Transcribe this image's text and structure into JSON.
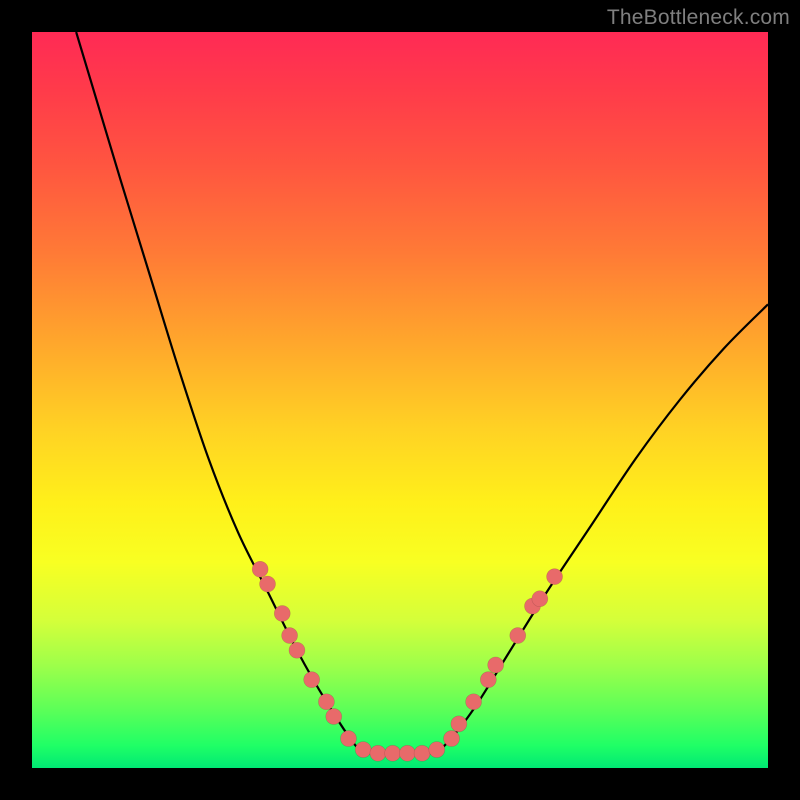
{
  "watermark": "TheBottleneck.com",
  "chart_data": {
    "type": "line",
    "title": "",
    "xlabel": "",
    "ylabel": "",
    "xlim": [
      0,
      100
    ],
    "ylim": [
      0,
      100
    ],
    "curve_left": [
      {
        "x": 6,
        "y": 100
      },
      {
        "x": 9,
        "y": 90
      },
      {
        "x": 12,
        "y": 80
      },
      {
        "x": 16,
        "y": 67
      },
      {
        "x": 20,
        "y": 54
      },
      {
        "x": 24,
        "y": 42
      },
      {
        "x": 28,
        "y": 32
      },
      {
        "x": 32,
        "y": 24
      },
      {
        "x": 36,
        "y": 16
      },
      {
        "x": 40,
        "y": 9
      },
      {
        "x": 44,
        "y": 3
      }
    ],
    "curve_flat": [
      {
        "x": 44,
        "y": 3
      },
      {
        "x": 46,
        "y": 2
      },
      {
        "x": 50,
        "y": 2
      },
      {
        "x": 54,
        "y": 2
      },
      {
        "x": 56,
        "y": 3
      }
    ],
    "curve_right": [
      {
        "x": 56,
        "y": 3
      },
      {
        "x": 60,
        "y": 8
      },
      {
        "x": 65,
        "y": 16
      },
      {
        "x": 70,
        "y": 24
      },
      {
        "x": 76,
        "y": 33
      },
      {
        "x": 82,
        "y": 42
      },
      {
        "x": 88,
        "y": 50
      },
      {
        "x": 94,
        "y": 57
      },
      {
        "x": 100,
        "y": 63
      }
    ],
    "dots": [
      {
        "x": 31,
        "y": 27
      },
      {
        "x": 32,
        "y": 25
      },
      {
        "x": 34,
        "y": 21
      },
      {
        "x": 35,
        "y": 18
      },
      {
        "x": 36,
        "y": 16
      },
      {
        "x": 38,
        "y": 12
      },
      {
        "x": 40,
        "y": 9
      },
      {
        "x": 41,
        "y": 7
      },
      {
        "x": 43,
        "y": 4
      },
      {
        "x": 45,
        "y": 2.5
      },
      {
        "x": 47,
        "y": 2
      },
      {
        "x": 49,
        "y": 2
      },
      {
        "x": 51,
        "y": 2
      },
      {
        "x": 53,
        "y": 2
      },
      {
        "x": 55,
        "y": 2.5
      },
      {
        "x": 57,
        "y": 4
      },
      {
        "x": 58,
        "y": 6
      },
      {
        "x": 60,
        "y": 9
      },
      {
        "x": 62,
        "y": 12
      },
      {
        "x": 63,
        "y": 14
      },
      {
        "x": 66,
        "y": 18
      },
      {
        "x": 68,
        "y": 22
      },
      {
        "x": 69,
        "y": 23
      },
      {
        "x": 71,
        "y": 26
      }
    ],
    "dot_color": "#e86a6a",
    "dot_radius": 8
  }
}
